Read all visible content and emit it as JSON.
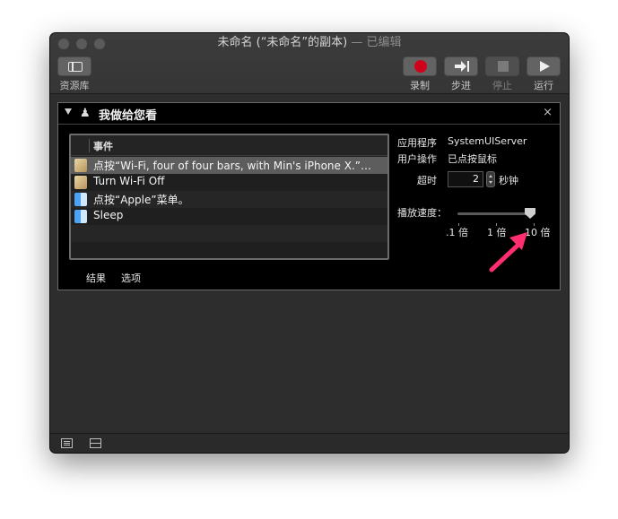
{
  "window": {
    "title_main": "未命名 (“未命名”的副本)",
    "title_suffix": " — 已编辑"
  },
  "toolbar": {
    "library_label": "资源库",
    "record_label": "录制",
    "step_label": "步进",
    "stop_label": "停止",
    "run_label": "运行"
  },
  "action": {
    "title": "我做给您看",
    "close": "×",
    "table": {
      "column_header": "事件",
      "rows": [
        {
          "text": "点按“Wi-Fi, four of four bars, with Min's iPhone X.”…",
          "icon": "script-icon",
          "selected": true
        },
        {
          "text": "Turn Wi-Fi Off",
          "icon": "script-icon",
          "selected": false
        },
        {
          "text": "点按“Apple”菜单。",
          "icon": "finder-icon",
          "selected": false
        },
        {
          "text": "Sleep",
          "icon": "finder-icon",
          "selected": false
        }
      ]
    },
    "properties": {
      "app_label": "应用程序",
      "app_value": "SystemUIServer",
      "user_action_label": "用户操作",
      "user_action_value": "已点按鼠标",
      "timeout_label": "超时",
      "timeout_value": "2",
      "timeout_unit": "秒钟",
      "speed_label": "播放速度：",
      "speed_ticks": [
        ".1 倍",
        "1 倍",
        "10 倍"
      ],
      "speed_value": "10 倍"
    },
    "tabs": [
      "结果",
      "选项"
    ]
  },
  "colors": {
    "record_red": "#d0021b",
    "annotation_arrow": "#ff2e6e"
  }
}
